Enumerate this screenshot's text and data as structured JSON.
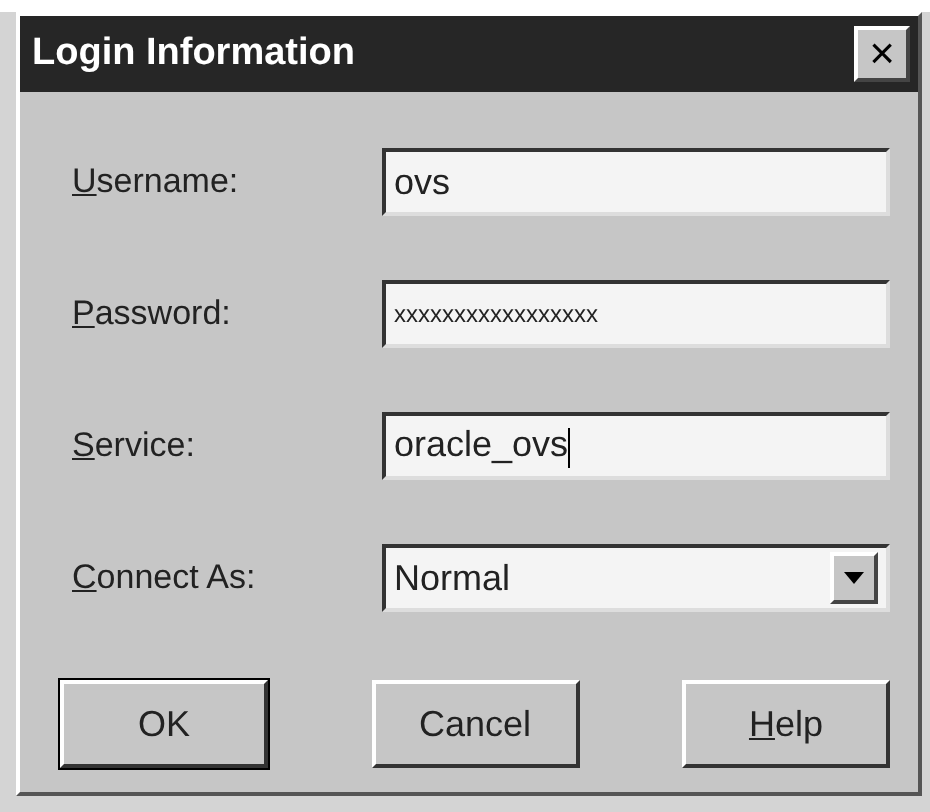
{
  "window": {
    "title": "Login Information",
    "close": "×"
  },
  "fields": [
    {
      "kind": "text",
      "label": "Username:",
      "underline_first": true,
      "value": "ovs",
      "focused": false
    },
    {
      "kind": "text",
      "label": "Password:",
      "underline_first": true,
      "value": "xxxxxxxxxxxxxxxxx",
      "focused": false
    },
    {
      "kind": "text",
      "label": "Service:",
      "underline_first": true,
      "value": "oracle_ovs",
      "focused": true
    },
    {
      "kind": "dropdown",
      "label": "Connect As:",
      "underline_first": true,
      "value": "Normal",
      "focused": false
    }
  ],
  "buttons": [
    {
      "label": "OK",
      "underline_first": false,
      "default": true
    },
    {
      "label": "Cancel",
      "underline_first": false,
      "default": false
    },
    {
      "label": "Help",
      "underline_first": true,
      "default": false
    }
  ]
}
